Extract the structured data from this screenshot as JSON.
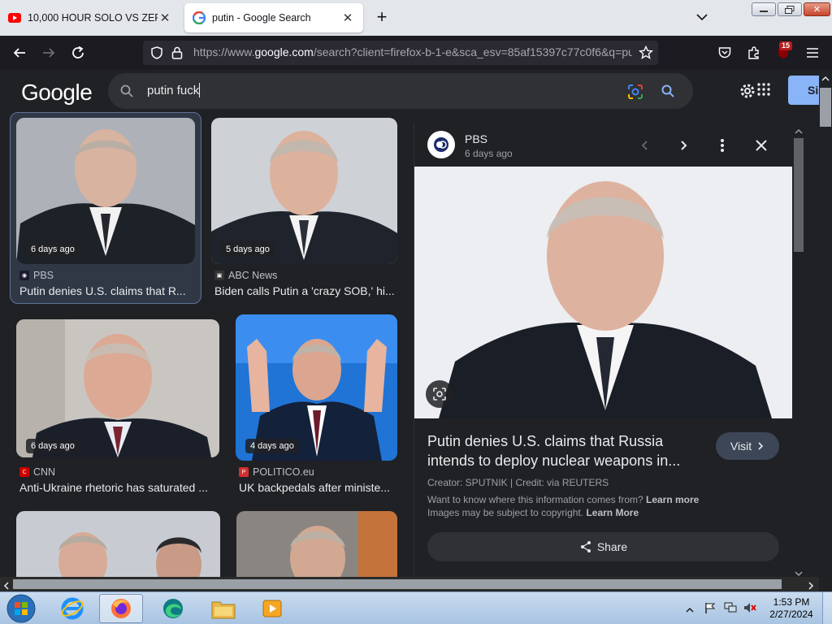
{
  "browser": {
    "tabs": [
      {
        "label": "10,000 HOUR SOLO VS ZERGS -",
        "favicon": "youtube-icon"
      },
      {
        "label": "putin - Google Search",
        "favicon": "google-icon"
      }
    ],
    "url_prefix": "https://www.",
    "url_host": "google.com",
    "url_rest": "/search?client=firefox-b-1-e&sca_esv=85af15397c77c0f6&q=pu",
    "extension_badge": "15"
  },
  "google": {
    "logo": "Google",
    "query": "putin fuck",
    "sign_in": "Si"
  },
  "results": [
    {
      "ago": "6 days ago",
      "source": "PBS",
      "title": "Putin denies U.S. claims that R...",
      "fav_color": "#1a1a2e"
    },
    {
      "ago": "5 days ago",
      "source": "ABC News",
      "title": "Biden calls Putin a 'crazy SOB,' hi...",
      "fav_color": "#333333"
    },
    {
      "ago": "6 days ago",
      "source": "CNN",
      "title": "Anti-Ukraine rhetoric has saturated ...",
      "fav_color": "#cc0000"
    },
    {
      "ago": "4 days ago",
      "source": "POLITICO.eu",
      "title": "UK backpedals after ministe...",
      "fav_color": "#d32f2f"
    }
  ],
  "preview": {
    "source": "PBS",
    "time": "6 days ago",
    "title": "Putin denies U.S. claims that Russia intends to deploy nuclear weapons in...",
    "visit": "Visit",
    "credit": "Creator: SPUTNIK | Credit: via REUTERS",
    "info1_text": "Want to know where this information comes from? ",
    "info1_link": "Learn more",
    "info2_text": "Images may be subject to copyright. ",
    "info2_link": "Learn More",
    "share": "Share"
  },
  "taskbar": {
    "time": "1:53 PM",
    "date": "2/27/2024"
  }
}
